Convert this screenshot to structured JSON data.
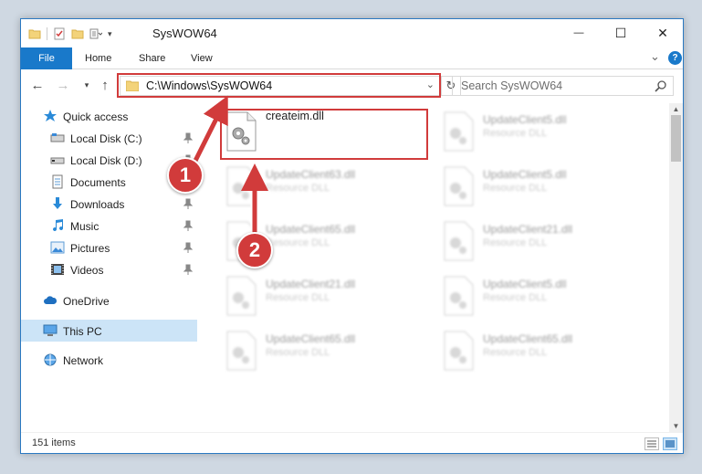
{
  "window": {
    "title": "SysWOW64",
    "minimize": "—",
    "maximize": "☐",
    "close": "✕"
  },
  "ribbon": {
    "tabs": [
      "File",
      "Home",
      "Share",
      "View"
    ],
    "expand": "⌄",
    "help": "?"
  },
  "address": {
    "path": "C:\\Windows\\SysWOW64",
    "search_placeholder": "Search SysWOW64"
  },
  "sidebar": {
    "items": [
      {
        "label": "Quick access",
        "icon": "star-icon",
        "pinned": false
      },
      {
        "label": "Local Disk (C:)",
        "icon": "drive-icon",
        "pinned": true
      },
      {
        "label": "Local Disk (D:)",
        "icon": "drive-icon",
        "pinned": true
      },
      {
        "label": "Documents",
        "icon": "documents-icon",
        "pinned": true
      },
      {
        "label": "Downloads",
        "icon": "download-icon",
        "pinned": true
      },
      {
        "label": "Music",
        "icon": "music-icon",
        "pinned": true
      },
      {
        "label": "Pictures",
        "icon": "pictures-icon",
        "pinned": true
      },
      {
        "label": "Videos",
        "icon": "video-icon",
        "pinned": true
      },
      {
        "label": "OneDrive",
        "icon": "cloud-icon",
        "pinned": false
      },
      {
        "label": "This PC",
        "icon": "pc-icon",
        "pinned": false
      },
      {
        "label": "Network",
        "icon": "network-icon",
        "pinned": false
      }
    ]
  },
  "files": [
    {
      "name": "createim.dll",
      "type": ""
    },
    {
      "name": "UpdateClient5.dll",
      "type": "Resource DLL"
    },
    {
      "name": "UpdateClient63.dll",
      "type": "Resource DLL"
    },
    {
      "name": "UpdateClient5.dll",
      "type": "Resource DLL"
    },
    {
      "name": "UpdateClient65.dll",
      "type": "Resource DLL"
    },
    {
      "name": "UpdateClient21.dll",
      "type": "Resource DLL"
    },
    {
      "name": "UpdateClient21.dll",
      "type": "Resource DLL"
    },
    {
      "name": "UpdateClient5.dll",
      "type": "Resource DLL"
    },
    {
      "name": "UpdateClient65.dll",
      "type": "Resource DLL"
    },
    {
      "name": "UpdateClient65.dll",
      "type": "Resource DLL"
    }
  ],
  "status": {
    "items": "151 items"
  },
  "annotations": {
    "step1": "1",
    "step2": "2"
  },
  "colors": {
    "accent": "#1979ca",
    "highlight": "#d13b3b",
    "selected": "#cce4f7"
  }
}
